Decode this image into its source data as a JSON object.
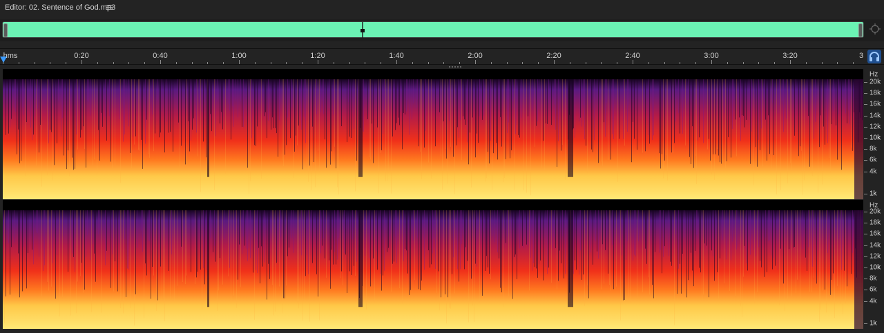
{
  "editor": {
    "title": "Editor: 02. Sentence of God.mp3"
  },
  "icons": {
    "menu": "hamburger-menu-icon",
    "zoom": "zoom-target-icon",
    "headphones": "headphones-icon"
  },
  "overview": {
    "waveform_color": "#6bf2b4",
    "playhead_position_fraction": 0.418
  },
  "ruler": {
    "unit_label": "hms",
    "ticks": [
      "0:20",
      "0:40",
      "1:00",
      "1:20",
      "1:40",
      "2:00",
      "2:20",
      "2:40",
      "3:00",
      "3:20",
      "3"
    ]
  },
  "frequency_scale": {
    "unit": "Hz",
    "labels": [
      "20k",
      "18k",
      "16k",
      "14k",
      "12k",
      "10k",
      "8k",
      "6k",
      "4k",
      "1k"
    ],
    "emphasized": [
      "10k",
      "1k"
    ]
  },
  "channels": [
    "left",
    "right"
  ],
  "colors": {
    "playhead": "#3a9bff",
    "spectrum_high": "#ffe56a",
    "spectrum_mid": "#ff3a10",
    "spectrum_low": "#6a1a8a"
  }
}
